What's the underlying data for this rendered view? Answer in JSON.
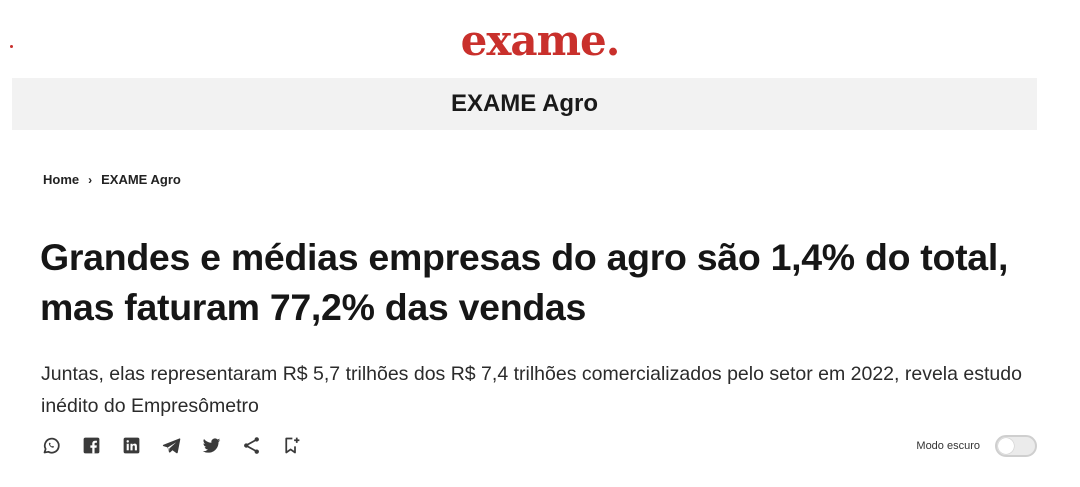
{
  "colors": {
    "brand": "#c9302c",
    "section_bar_bg": "#f2f2f2",
    "text": "#161616",
    "icon": "#3a3a3a"
  },
  "header": {
    "logo_text": "exame."
  },
  "section": {
    "title": "EXAME Agro"
  },
  "breadcrumb": {
    "home": "Home",
    "separator": "›",
    "current": "EXAME Agro"
  },
  "article": {
    "headline": "Grandes e médias empresas do agro são 1,4% do total, mas faturam 77,2% das vendas",
    "subtitle": "Juntas, elas representaram R$ 5,7 trilhões dos R$ 7,4 trilhões comercializados pelo setor em 2022, revela estudo inédito do Empresômetro"
  },
  "share_icons": [
    "whatsapp-icon",
    "facebook-icon",
    "linkedin-icon",
    "telegram-icon",
    "twitter-icon",
    "share-icon",
    "bookmark-add-icon"
  ],
  "dark_mode": {
    "label": "Modo escuro",
    "enabled": false
  }
}
